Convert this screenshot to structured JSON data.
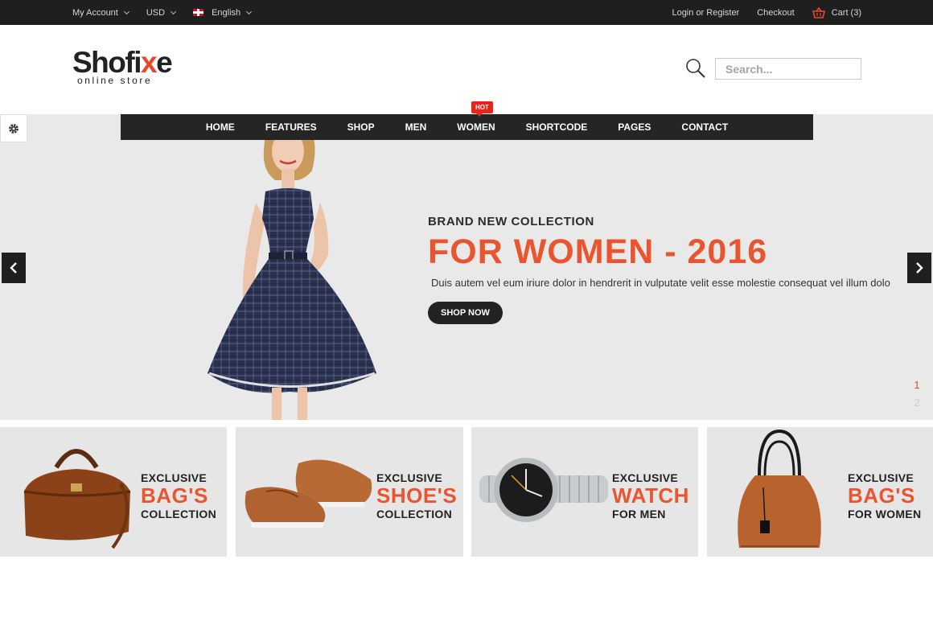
{
  "topbar": {
    "account": "My Account",
    "currency": "USD",
    "language": "English",
    "login": "Login or Register",
    "checkout": "Checkout",
    "cart": "Cart (3)"
  },
  "header": {
    "logo_main_a": "Shofi",
    "logo_main_x": "x",
    "logo_main_b": "e",
    "logo_sub": "online store",
    "search_placeholder": "Search..."
  },
  "nav": {
    "items": [
      "HOME",
      "FEATURES",
      "SHOP",
      "MEN",
      "WOMEN",
      "SHORTCODE",
      "PAGES",
      "CONTACT"
    ],
    "hot_badge": "HOT"
  },
  "hero": {
    "eyebrow": "BRAND NEW COLLECTION",
    "title": "FOR WOMEN - 2016",
    "description": "Duis autem vel eum iriure dolor in hendrerit in vulputate velit esse molestie consequat vel illum dolo",
    "button": "SHOP NOW",
    "pages": [
      "1",
      "2"
    ]
  },
  "banners": [
    {
      "line1": "EXCLUSIVE",
      "line2": "BAG'S",
      "line3": "COLLECTION"
    },
    {
      "line1": "EXCLUSIVE",
      "line2": "SHOE'S",
      "line3": "COLLECTION"
    },
    {
      "line1": "EXCLUSIVE",
      "line2": "WATCH",
      "line3": "FOR MEN"
    },
    {
      "line1": "EXCLUSIVE",
      "line2": "BAG'S",
      "line3": "FOR WOMEN"
    }
  ],
  "colors": {
    "accent": "#e8552f",
    "dark": "#222222",
    "hero_bg": "#e9e9e9"
  }
}
